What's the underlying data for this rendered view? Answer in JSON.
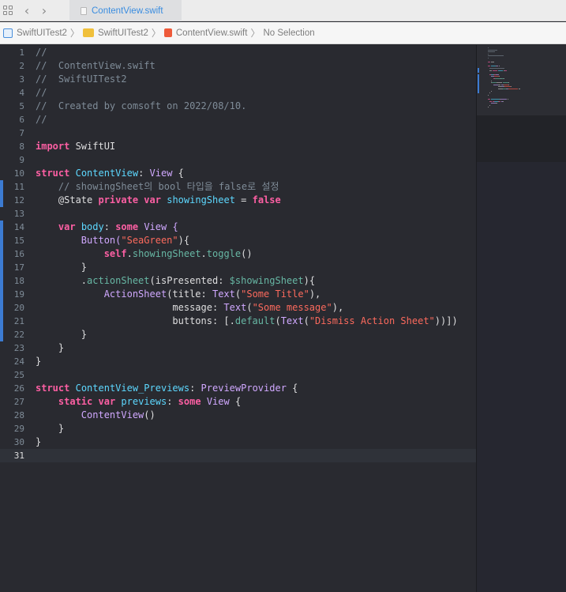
{
  "tab": {
    "title": "ContentView.swift"
  },
  "breadcrumb": {
    "project": "SwiftUITest2",
    "folder": "SwiftUITest2",
    "file": "ContentView.swift",
    "selection": "No Selection"
  },
  "editor": {
    "current_line": 31,
    "changed_lines": [
      11,
      12,
      14,
      15,
      16,
      17,
      18,
      19,
      20,
      21,
      22
    ],
    "lines": [
      {
        "n": "1",
        "tokens": [
          {
            "t": "//",
            "c": "com"
          }
        ]
      },
      {
        "n": "2",
        "tokens": [
          {
            "t": "//  ContentView.swift",
            "c": "com"
          }
        ]
      },
      {
        "n": "3",
        "tokens": [
          {
            "t": "//  SwiftUITest2",
            "c": "com"
          }
        ]
      },
      {
        "n": "4",
        "tokens": [
          {
            "t": "//",
            "c": "com"
          }
        ]
      },
      {
        "n": "5",
        "tokens": [
          {
            "t": "//  Created by comsoft on 2022/08/10.",
            "c": "com"
          }
        ]
      },
      {
        "n": "6",
        "tokens": [
          {
            "t": "//",
            "c": "com"
          }
        ]
      },
      {
        "n": "7",
        "tokens": []
      },
      {
        "n": "8",
        "tokens": [
          {
            "t": "import",
            "c": "kw"
          },
          {
            "t": " SwiftUI",
            "c": ""
          }
        ]
      },
      {
        "n": "9",
        "tokens": []
      },
      {
        "n": "10",
        "tokens": [
          {
            "t": "struct",
            "c": "kw"
          },
          {
            "t": " ",
            "c": ""
          },
          {
            "t": "ContentView",
            "c": "decl"
          },
          {
            "t": ": ",
            "c": ""
          },
          {
            "t": "View",
            "c": "type"
          },
          {
            "t": " {",
            "c": ""
          }
        ]
      },
      {
        "n": "11",
        "tokens": [
          {
            "t": "    // showingSheet의 bool 타입을 false로 설정",
            "c": "com"
          }
        ]
      },
      {
        "n": "12",
        "tokens": [
          {
            "t": "    @State ",
            "c": ""
          },
          {
            "t": "private",
            "c": "kw"
          },
          {
            "t": " ",
            "c": ""
          },
          {
            "t": "var",
            "c": "kw"
          },
          {
            "t": " ",
            "c": ""
          },
          {
            "t": "showingSheet",
            "c": "decl"
          },
          {
            "t": " = ",
            "c": ""
          },
          {
            "t": "false",
            "c": "kw"
          }
        ]
      },
      {
        "n": "13",
        "tokens": []
      },
      {
        "n": "14",
        "tokens": [
          {
            "t": "    ",
            "c": ""
          },
          {
            "t": "var",
            "c": "kw"
          },
          {
            "t": " ",
            "c": ""
          },
          {
            "t": "body",
            "c": "decl"
          },
          {
            "t": ": ",
            "c": ""
          },
          {
            "t": "some",
            "c": "kw"
          },
          {
            "t": " View {",
            "c": "type"
          }
        ]
      },
      {
        "n": "15",
        "tokens": [
          {
            "t": "        Button(",
            "c": "type"
          },
          {
            "t": "\"SeaGreen\"",
            "c": "str"
          },
          {
            "t": "){",
            "c": ""
          }
        ]
      },
      {
        "n": "16",
        "tokens": [
          {
            "t": "            ",
            "c": ""
          },
          {
            "t": "self",
            "c": "kw"
          },
          {
            "t": ".",
            "c": ""
          },
          {
            "t": "showingSheet",
            "c": "func"
          },
          {
            "t": ".",
            "c": ""
          },
          {
            "t": "toggle",
            "c": "func"
          },
          {
            "t": "()",
            "c": ""
          }
        ]
      },
      {
        "n": "17",
        "tokens": [
          {
            "t": "        }",
            "c": ""
          }
        ]
      },
      {
        "n": "18",
        "tokens": [
          {
            "t": "        .",
            "c": ""
          },
          {
            "t": "actionSheet",
            "c": "func"
          },
          {
            "t": "(isPresented: ",
            "c": ""
          },
          {
            "t": "$showingSheet",
            "c": "func"
          },
          {
            "t": "){",
            "c": ""
          }
        ]
      },
      {
        "n": "19",
        "tokens": [
          {
            "t": "            ",
            "c": ""
          },
          {
            "t": "ActionSheet",
            "c": "type"
          },
          {
            "t": "(title: ",
            "c": ""
          },
          {
            "t": "Text",
            "c": "type"
          },
          {
            "t": "(",
            "c": ""
          },
          {
            "t": "\"Some Title\"",
            "c": "str"
          },
          {
            "t": "),",
            "c": ""
          }
        ]
      },
      {
        "n": "20",
        "tokens": [
          {
            "t": "                        message: ",
            "c": ""
          },
          {
            "t": "Text",
            "c": "type"
          },
          {
            "t": "(",
            "c": ""
          },
          {
            "t": "\"Some message\"",
            "c": "str"
          },
          {
            "t": "),",
            "c": ""
          }
        ]
      },
      {
        "n": "21",
        "tokens": [
          {
            "t": "                        buttons: [.",
            "c": ""
          },
          {
            "t": "default",
            "c": "func"
          },
          {
            "t": "(",
            "c": ""
          },
          {
            "t": "Text",
            "c": "type"
          },
          {
            "t": "(",
            "c": ""
          },
          {
            "t": "\"Dismiss Action Sheet\"",
            "c": "str"
          },
          {
            "t": "))])",
            "c": ""
          }
        ]
      },
      {
        "n": "22",
        "tokens": [
          {
            "t": "        }",
            "c": ""
          }
        ]
      },
      {
        "n": "23",
        "tokens": [
          {
            "t": "    }",
            "c": ""
          }
        ]
      },
      {
        "n": "24",
        "tokens": [
          {
            "t": "}",
            "c": ""
          }
        ]
      },
      {
        "n": "25",
        "tokens": []
      },
      {
        "n": "26",
        "tokens": [
          {
            "t": "struct",
            "c": "kw"
          },
          {
            "t": " ",
            "c": ""
          },
          {
            "t": "ContentView_Previews",
            "c": "decl"
          },
          {
            "t": ": ",
            "c": ""
          },
          {
            "t": "PreviewProvider",
            "c": "type"
          },
          {
            "t": " {",
            "c": ""
          }
        ]
      },
      {
        "n": "27",
        "tokens": [
          {
            "t": "    ",
            "c": ""
          },
          {
            "t": "static",
            "c": "kw"
          },
          {
            "t": " ",
            "c": ""
          },
          {
            "t": "var",
            "c": "kw"
          },
          {
            "t": " ",
            "c": ""
          },
          {
            "t": "previews",
            "c": "decl"
          },
          {
            "t": ": ",
            "c": ""
          },
          {
            "t": "some",
            "c": "kw"
          },
          {
            "t": " ",
            "c": ""
          },
          {
            "t": "View",
            "c": "type"
          },
          {
            "t": " {",
            "c": ""
          }
        ]
      },
      {
        "n": "28",
        "tokens": [
          {
            "t": "        ",
            "c": ""
          },
          {
            "t": "ContentView",
            "c": "type"
          },
          {
            "t": "()",
            "c": ""
          }
        ]
      },
      {
        "n": "29",
        "tokens": [
          {
            "t": "    }",
            "c": ""
          }
        ]
      },
      {
        "n": "30",
        "tokens": [
          {
            "t": "}",
            "c": ""
          }
        ]
      },
      {
        "n": "31",
        "tokens": []
      }
    ]
  },
  "colors": {
    "comment": "#7f8c98",
    "keyword": "#fc5fa3",
    "type": "#d0a8ff",
    "declaration": "#5dd8ff",
    "string": "#fc6a5d",
    "function": "#67b7a4",
    "change_bar": "#3c7bd2",
    "tab_title": "#3a8de0"
  },
  "icons": {
    "layout": "grid-icon",
    "back": "chevron-left-icon",
    "forward": "chevron-right-icon",
    "file": "swift-file-icon",
    "project": "xcode-project-icon",
    "folder": "folder-icon"
  }
}
